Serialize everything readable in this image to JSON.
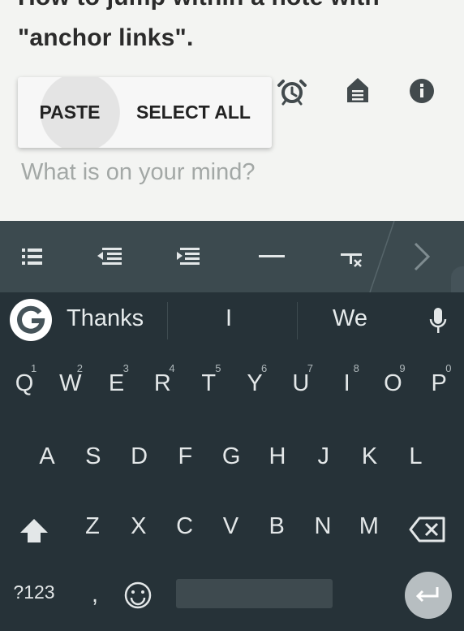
{
  "note": {
    "title_line1": "How to jump within a note with",
    "title_line2": "\"anchor links\".",
    "placeholder": "What is on your mind?"
  },
  "context_menu": {
    "paste": "PASTE",
    "select_all": "SELECT ALL"
  },
  "toolbar_icons": [
    "alarm-icon",
    "note-lock-icon",
    "info-icon"
  ],
  "format_bar": [
    "bullet-list-icon",
    "outdent-icon",
    "indent-icon",
    "horizontal-rule-icon",
    "clear-format-icon",
    "chevron-right-icon"
  ],
  "suggestions": {
    "left": "Thanks",
    "center": "I",
    "right": "We"
  },
  "keyboard": {
    "row1": [
      "Q",
      "W",
      "E",
      "R",
      "T",
      "Y",
      "U",
      "I",
      "O",
      "P"
    ],
    "row1_hints": [
      "1",
      "2",
      "3",
      "4",
      "5",
      "6",
      "7",
      "8",
      "9",
      "0"
    ],
    "row2": [
      "A",
      "S",
      "D",
      "F",
      "G",
      "H",
      "J",
      "K",
      "L"
    ],
    "row3": [
      "Z",
      "X",
      "C",
      "V",
      "B",
      "N",
      "M"
    ],
    "symbols": "?123",
    "comma": ","
  },
  "colors": {
    "keyboard_bg": "#263238",
    "format_bar_bg": "#3c4a4f",
    "note_bg": "#f3f4f2"
  }
}
